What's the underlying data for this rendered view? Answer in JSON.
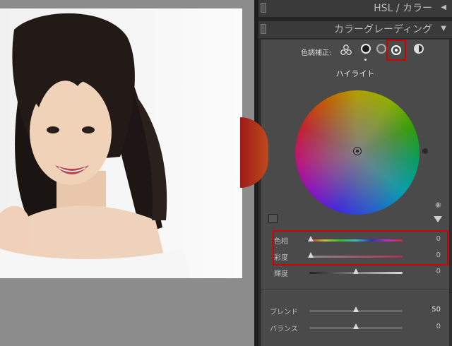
{
  "panels": {
    "hsl_title": "HSL / カラー",
    "grading_title": "カラーグレーディング",
    "collapse_arrow": "◀",
    "expand_arrow": "▼"
  },
  "grading": {
    "mode_label": "色調補正:",
    "wheel_title": "ハイライト",
    "sliders": [
      {
        "label": "色相",
        "value": "0",
        "fraction": 0.0
      },
      {
        "label": "彩度",
        "value": "0",
        "fraction": 0.0
      },
      {
        "label": "輝度",
        "value": "0",
        "fraction": 0.5
      }
    ],
    "blend": {
      "label": "ブレンド",
      "value": "50",
      "fraction": 0.5
    },
    "balance": {
      "label": "バランス",
      "value": "0",
      "fraction": 0.5
    }
  },
  "colors": {
    "highlight": "#d00000",
    "panel_bg": "#4a4a4a"
  }
}
